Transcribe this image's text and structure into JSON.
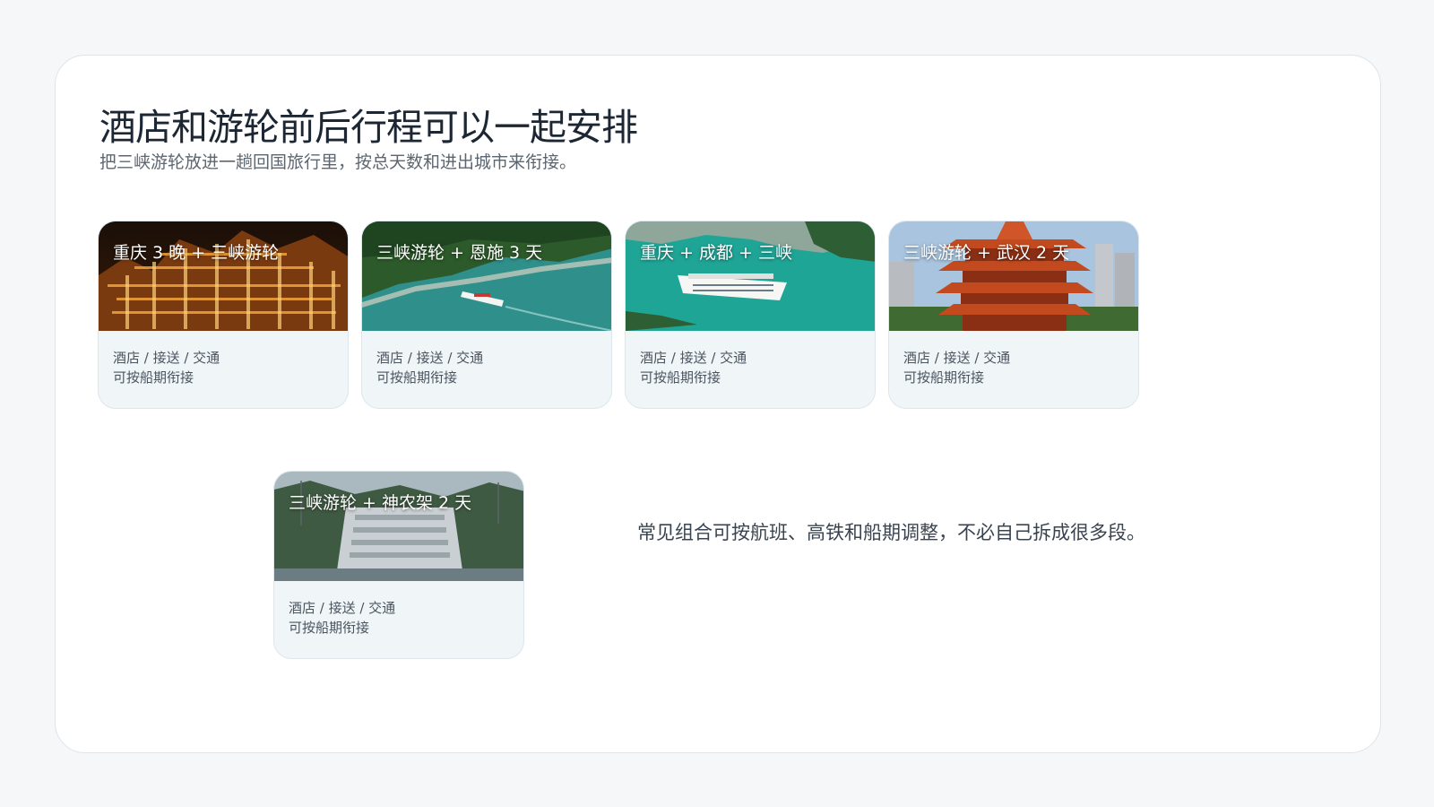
{
  "header": {
    "title": "酒店和游轮前后行程可以一起安排",
    "subtitle": "把三峡游轮放进一趟回国旅行里，按总天数和进出城市来衔接。"
  },
  "cards": [
    {
      "caption": "重庆 3 晚 + 三峡游轮",
      "line1": "酒店 / 接送 / 交通",
      "line2": "可按船期衔接",
      "image": "chongqing-night-city-photo"
    },
    {
      "caption": "三峡游轮 + 恩施 3 天",
      "line1": "酒店 / 接送 / 交通",
      "line2": "可按船期衔接",
      "image": "river-gorge-cruise-photo"
    },
    {
      "caption": "重庆 + 成都 + 三峡",
      "line1": "酒店 / 接送 / 交通",
      "line2": "可按船期衔接",
      "image": "cruise-ship-green-river-photo"
    },
    {
      "caption": "三峡游轮 + 武汉 2 天",
      "line1": "酒店 / 接送 / 交通",
      "line2": "可按船期衔接",
      "image": "yellow-crane-tower-photo"
    },
    {
      "caption": "三峡游轮 + 神农架 2 天",
      "line1": "酒店 / 接送 / 交通",
      "line2": "可按船期衔接",
      "image": "three-gorges-dam-locks-photo"
    }
  ],
  "note": "常见组合可按航班、高铁和船期调整，不必自己拆成很多段。",
  "colors": {
    "background": "#f5f7f9",
    "panel": "#ffffff",
    "card_body": "#f0f5f8",
    "title": "#1c2733",
    "subtitle": "#5c6670"
  }
}
